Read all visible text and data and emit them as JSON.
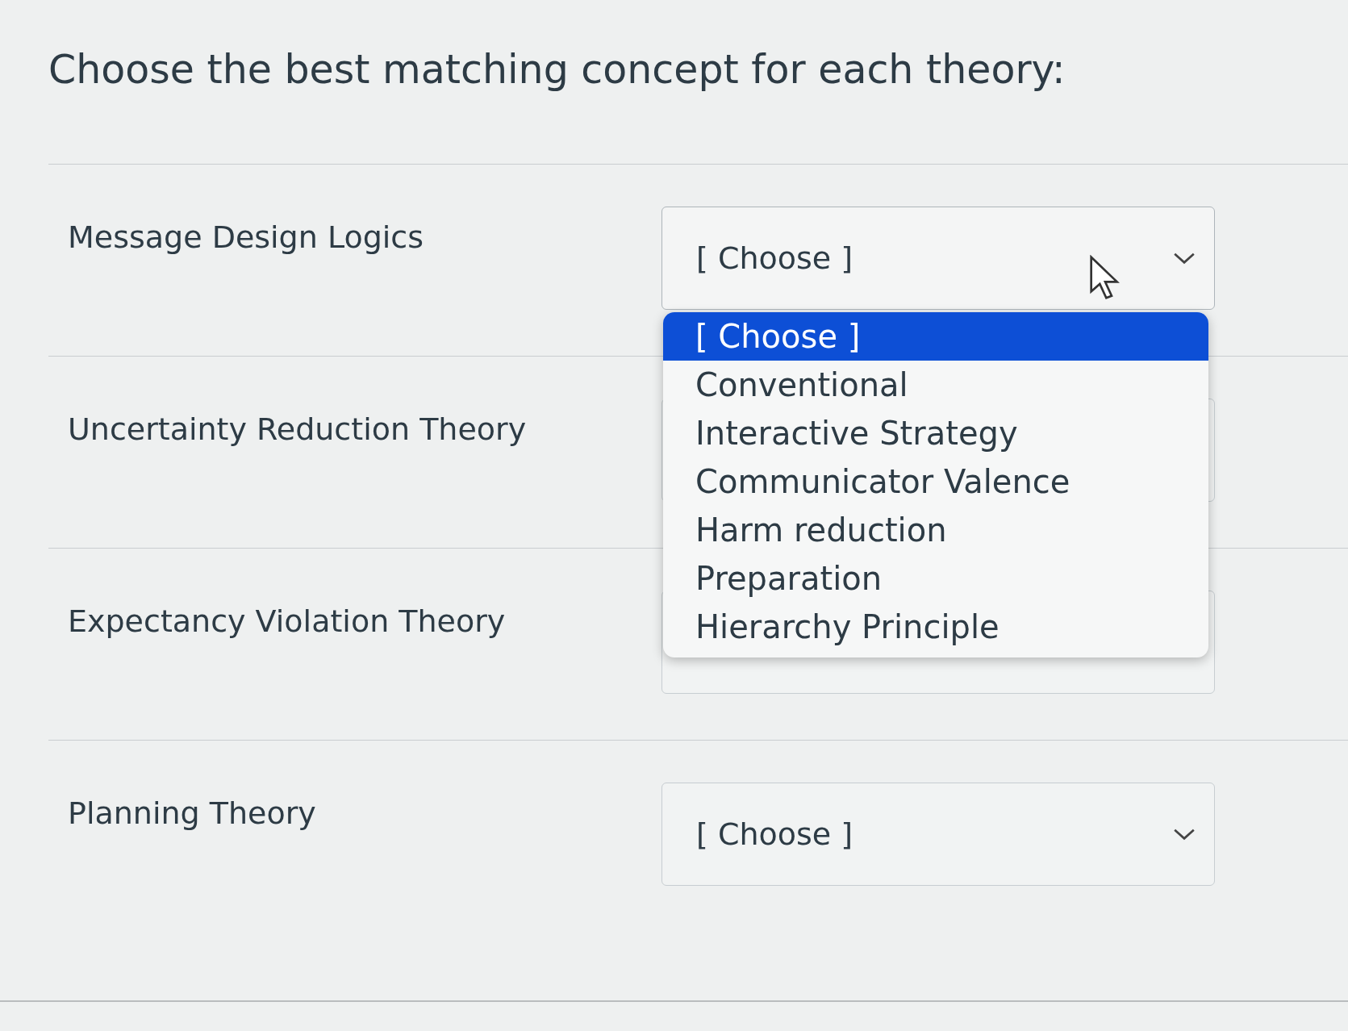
{
  "heading": "Choose the best matching concept for each theory:",
  "rows": [
    {
      "label": "Message Design Logics",
      "select": {
        "value": "[ Choose ]",
        "expanded": true
      }
    },
    {
      "label": "Uncertainty Reduction Theory",
      "select": {
        "expanded": false
      }
    },
    {
      "label": "Expectancy Violation Theory",
      "select": {
        "expanded": false
      }
    },
    {
      "label": "Planning Theory",
      "select": {
        "value": "[ Choose ]",
        "expanded": false
      }
    }
  ],
  "dropdown": {
    "options": [
      {
        "label": "[ Choose ]",
        "selected": true
      },
      {
        "label": "Conventional",
        "selected": false
      },
      {
        "label": "Interactive Strategy",
        "selected": false
      },
      {
        "label": "Communicator Valence",
        "selected": false
      },
      {
        "label": "Harm reduction",
        "selected": false
      },
      {
        "label": "Preparation",
        "selected": false
      },
      {
        "label": "Hierarchy Principle",
        "selected": false
      }
    ]
  }
}
